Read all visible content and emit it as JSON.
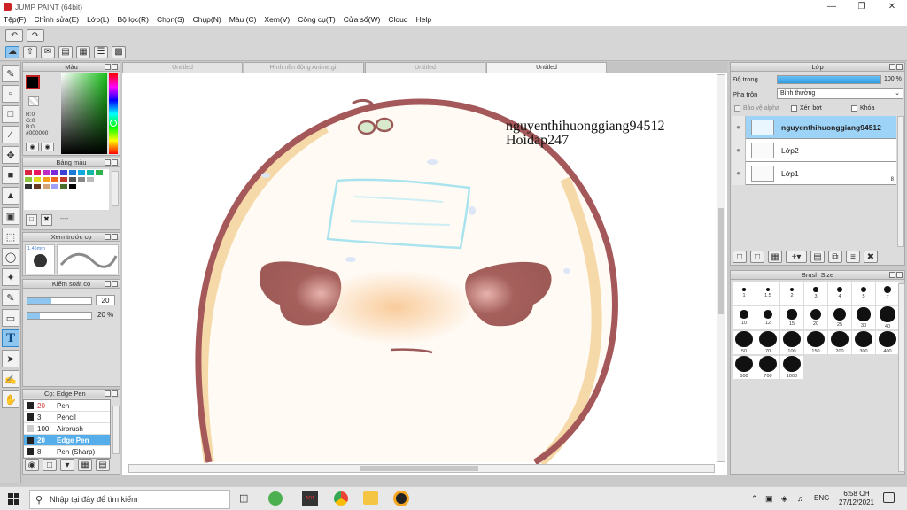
{
  "window": {
    "title": "JUMP PAINT (64bit)"
  },
  "menu": [
    "Tệp(F)",
    "Chỉnh sửa(E)",
    "Lớp(L)",
    "Bộ lọc(R)",
    "Chọn(S)",
    "Chụp(N)",
    "Màu (C)",
    "Xem(V)",
    "Công cụ(T)",
    "Cửa sổ(W)",
    "Cloud",
    "Help"
  ],
  "doc_tabs": [
    "Untitled",
    "Hình nền động Anime.gif",
    "Untitled",
    "Untitled"
  ],
  "color_panel": {
    "title": "Màu",
    "r": "R:0",
    "g": "G:0",
    "b": "B:0",
    "hex": "#000000",
    "foreground": "#000000"
  },
  "palette_panel": {
    "title": "Bảng màu",
    "colors": [
      "#d7263d",
      "#e8175d",
      "#c02bc4",
      "#7a2ad8",
      "#3a42d6",
      "#1c7ad9",
      "#10a9e0",
      "#16b7a7",
      "#2db24c",
      "#8cc63f",
      "#e0d91f",
      "#f6a21c",
      "#f0671f",
      "#c0392b",
      "#555555",
      "#888888",
      "#bbbbbb",
      "#ffffff",
      "#333333",
      "#6b3b1f",
      "#d4a373",
      "#a0a0ff",
      "#4c6e2c",
      "#000000"
    ],
    "footer_text": "----"
  },
  "preview_panel": {
    "title": "Xem trước cọ",
    "size": "1.45mm"
  },
  "brush_control": {
    "title": "Kiểm soát cọ",
    "size_value": "20",
    "opacity_value": "20 %"
  },
  "brush_list": {
    "title": "Cọ: Edge Pen",
    "items": [
      {
        "size": "20",
        "name": "Pen"
      },
      {
        "size": "3",
        "name": "Pencil"
      },
      {
        "size": "100",
        "name": "Airbrush"
      },
      {
        "size": "20",
        "name": "Edge Pen"
      },
      {
        "size": "8",
        "name": "Pen (Sharp)"
      }
    ]
  },
  "layer_panel": {
    "title": "Lớp",
    "opacity_label": "Độ trong",
    "opacity_value": "100 %",
    "blend_label": "Pha trộn",
    "blend_value": "Bình thường",
    "protect_alpha": "Bảo vệ alpha",
    "clipping": "Xén bớt",
    "lock": "Khóa",
    "layers": [
      {
        "name": "nguyenthihuonggiang94512",
        "selected": true
      },
      {
        "name": "Lớp2",
        "selected": false
      },
      {
        "name": "Lớp1",
        "selected": false,
        "badge": "8"
      }
    ]
  },
  "brush_size_panel": {
    "title": "Brush Size",
    "sizes": [
      "1",
      "1.5",
      "2",
      "3",
      "4",
      "5",
      "7",
      "10",
      "12",
      "15",
      "20",
      "25",
      "30",
      "40",
      "50",
      "70",
      "100",
      "150",
      "200",
      "300",
      "400",
      "500",
      "700",
      "1000"
    ]
  },
  "canvas": {
    "watermark_line1": "nguyenthihuonggiang94512",
    "watermark_line2": "Hoidap247"
  },
  "taskbar": {
    "search_placeholder": "Nhập tại đây để tìm kiếm",
    "language": "ENG",
    "time": "6:58 CH",
    "date": "27/12/2021"
  }
}
